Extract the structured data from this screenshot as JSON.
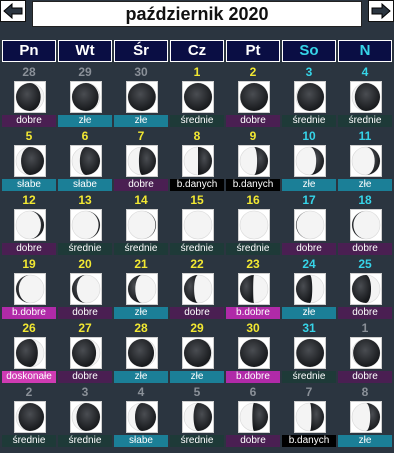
{
  "header": {
    "title": "październik 2020"
  },
  "weekdays": [
    "Pn",
    "Wt",
    "Śr",
    "Cz",
    "Pt",
    "So",
    "N"
  ],
  "colors": {
    "background": "#2b3540",
    "weekday_bg": "#0a0e44",
    "current_day": "#f2e832",
    "weekend_day": "#36d4e8",
    "other_month_day": "#8a9098",
    "dobre": "#4a1f52",
    "zle": "#1b7f97",
    "srednie": "#1e3a38",
    "slabe": "#1b7f97",
    "b_danych": "#000000",
    "b_dobre": "#b02aa8",
    "doskonale": "#cf3bb3"
  },
  "weeks": [
    [
      {
        "day": "28",
        "label": "dobre",
        "cls": "dobre",
        "lit": 0.88,
        "side": "L",
        "cur": false
      },
      {
        "day": "29",
        "label": "złe",
        "cls": "zle",
        "lit": 0.95,
        "side": "L",
        "cur": false
      },
      {
        "day": "30",
        "label": "złe",
        "cls": "zle",
        "lit": 0.99,
        "side": "L",
        "cur": false
      },
      {
        "day": "1",
        "label": "średnie",
        "cls": "srednie",
        "lit": 1.0,
        "side": "L",
        "cur": true
      },
      {
        "day": "2",
        "label": "dobre",
        "cls": "dobre",
        "lit": 0.99,
        "side": "R",
        "cur": true
      },
      {
        "day": "3",
        "label": "średnie",
        "cls": "srednie",
        "lit": 0.96,
        "side": "R",
        "cur": true
      },
      {
        "day": "4",
        "label": "średnie",
        "cls": "srednie",
        "lit": 0.9,
        "side": "R",
        "cur": true
      }
    ],
    [
      {
        "day": "5",
        "label": "słabe",
        "cls": "slabe",
        "lit": 0.82,
        "side": "R",
        "cur": true
      },
      {
        "day": "6",
        "label": "słabe",
        "cls": "slabe",
        "lit": 0.72,
        "side": "R",
        "cur": true
      },
      {
        "day": "7",
        "label": "dobre",
        "cls": "dobre",
        "lit": 0.61,
        "side": "R",
        "cur": true
      },
      {
        "day": "8",
        "label": "b.danych",
        "cls": "bdanych",
        "lit": 0.5,
        "side": "R",
        "cur": true
      },
      {
        "day": "9",
        "label": "b.danych",
        "cls": "bdanych",
        "lit": 0.39,
        "side": "R",
        "cur": true
      },
      {
        "day": "10",
        "label": "złe",
        "cls": "zle",
        "lit": 0.28,
        "side": "R",
        "cur": true
      },
      {
        "day": "11",
        "label": "złe",
        "cls": "zle",
        "lit": 0.19,
        "side": "R",
        "cur": true
      }
    ],
    [
      {
        "day": "12",
        "label": "dobre",
        "cls": "dobre",
        "lit": 0.11,
        "side": "R",
        "cur": true
      },
      {
        "day": "13",
        "label": "średnie",
        "cls": "srednie",
        "lit": 0.05,
        "side": "R",
        "cur": true
      },
      {
        "day": "14",
        "label": "średnie",
        "cls": "srednie",
        "lit": 0.02,
        "side": "R",
        "cur": true
      },
      {
        "day": "15",
        "label": "średnie",
        "cls": "srednie",
        "lit": 0.0,
        "side": "R",
        "cur": true
      },
      {
        "day": "16",
        "label": "średnie",
        "cls": "srednie",
        "lit": 0.0,
        "side": "L",
        "cur": true
      },
      {
        "day": "17",
        "label": "dobre",
        "cls": "dobre",
        "lit": 0.02,
        "side": "L",
        "cur": true
      },
      {
        "day": "18",
        "label": "dobre",
        "cls": "dobre",
        "lit": 0.05,
        "side": "L",
        "cur": true
      }
    ],
    [
      {
        "day": "19",
        "label": "b.dobre",
        "cls": "bdobre",
        "lit": 0.1,
        "side": "L",
        "cur": true
      },
      {
        "day": "20",
        "label": "dobre",
        "cls": "dobre",
        "lit": 0.17,
        "side": "L",
        "cur": true
      },
      {
        "day": "21",
        "label": "złe",
        "cls": "zle",
        "lit": 0.26,
        "side": "L",
        "cur": true
      },
      {
        "day": "22",
        "label": "dobre",
        "cls": "dobre",
        "lit": 0.36,
        "side": "L",
        "cur": true
      },
      {
        "day": "23",
        "label": "b.dobre",
        "cls": "bdobre",
        "lit": 0.47,
        "side": "L",
        "cur": true
      },
      {
        "day": "24",
        "label": "złe",
        "cls": "zle",
        "lit": 0.58,
        "side": "L",
        "cur": true
      },
      {
        "day": "25",
        "label": "dobre",
        "cls": "dobre",
        "lit": 0.68,
        "side": "L",
        "cur": true
      }
    ],
    [
      {
        "day": "26",
        "label": "doskonałe",
        "cls": "doskonale",
        "lit": 0.78,
        "side": "L",
        "cur": true
      },
      {
        "day": "27",
        "label": "dobre",
        "cls": "dobre",
        "lit": 0.86,
        "side": "L",
        "cur": true
      },
      {
        "day": "28",
        "label": "złe",
        "cls": "zle",
        "lit": 0.93,
        "side": "L",
        "cur": true
      },
      {
        "day": "29",
        "label": "złe",
        "cls": "zle",
        "lit": 0.97,
        "side": "L",
        "cur": true
      },
      {
        "day": "30",
        "label": "b.dobre",
        "cls": "bdobre",
        "lit": 1.0,
        "side": "L",
        "cur": true
      },
      {
        "day": "31",
        "label": "średnie",
        "cls": "srednie",
        "lit": 0.99,
        "side": "R",
        "cur": true
      },
      {
        "day": "1",
        "label": "dobre",
        "cls": "dobre",
        "lit": 0.96,
        "side": "R",
        "cur": false
      }
    ],
    [
      {
        "day": "2",
        "label": "średnie",
        "cls": "srednie",
        "lit": 0.91,
        "side": "R",
        "cur": false
      },
      {
        "day": "3",
        "label": "średnie",
        "cls": "srednie",
        "lit": 0.84,
        "side": "R",
        "cur": false
      },
      {
        "day": "4",
        "label": "słabe",
        "cls": "slabe",
        "lit": 0.75,
        "side": "R",
        "cur": false
      },
      {
        "day": "5",
        "label": "średnie",
        "cls": "srednie",
        "lit": 0.66,
        "side": "R",
        "cur": false
      },
      {
        "day": "6",
        "label": "dobre",
        "cls": "dobre",
        "lit": 0.56,
        "side": "R",
        "cur": false
      },
      {
        "day": "7",
        "label": "b.danych",
        "cls": "bdanych",
        "lit": 0.45,
        "side": "R",
        "cur": false
      },
      {
        "day": "8",
        "label": "złe",
        "cls": "zle",
        "lit": 0.35,
        "side": "R",
        "cur": false
      }
    ]
  ]
}
